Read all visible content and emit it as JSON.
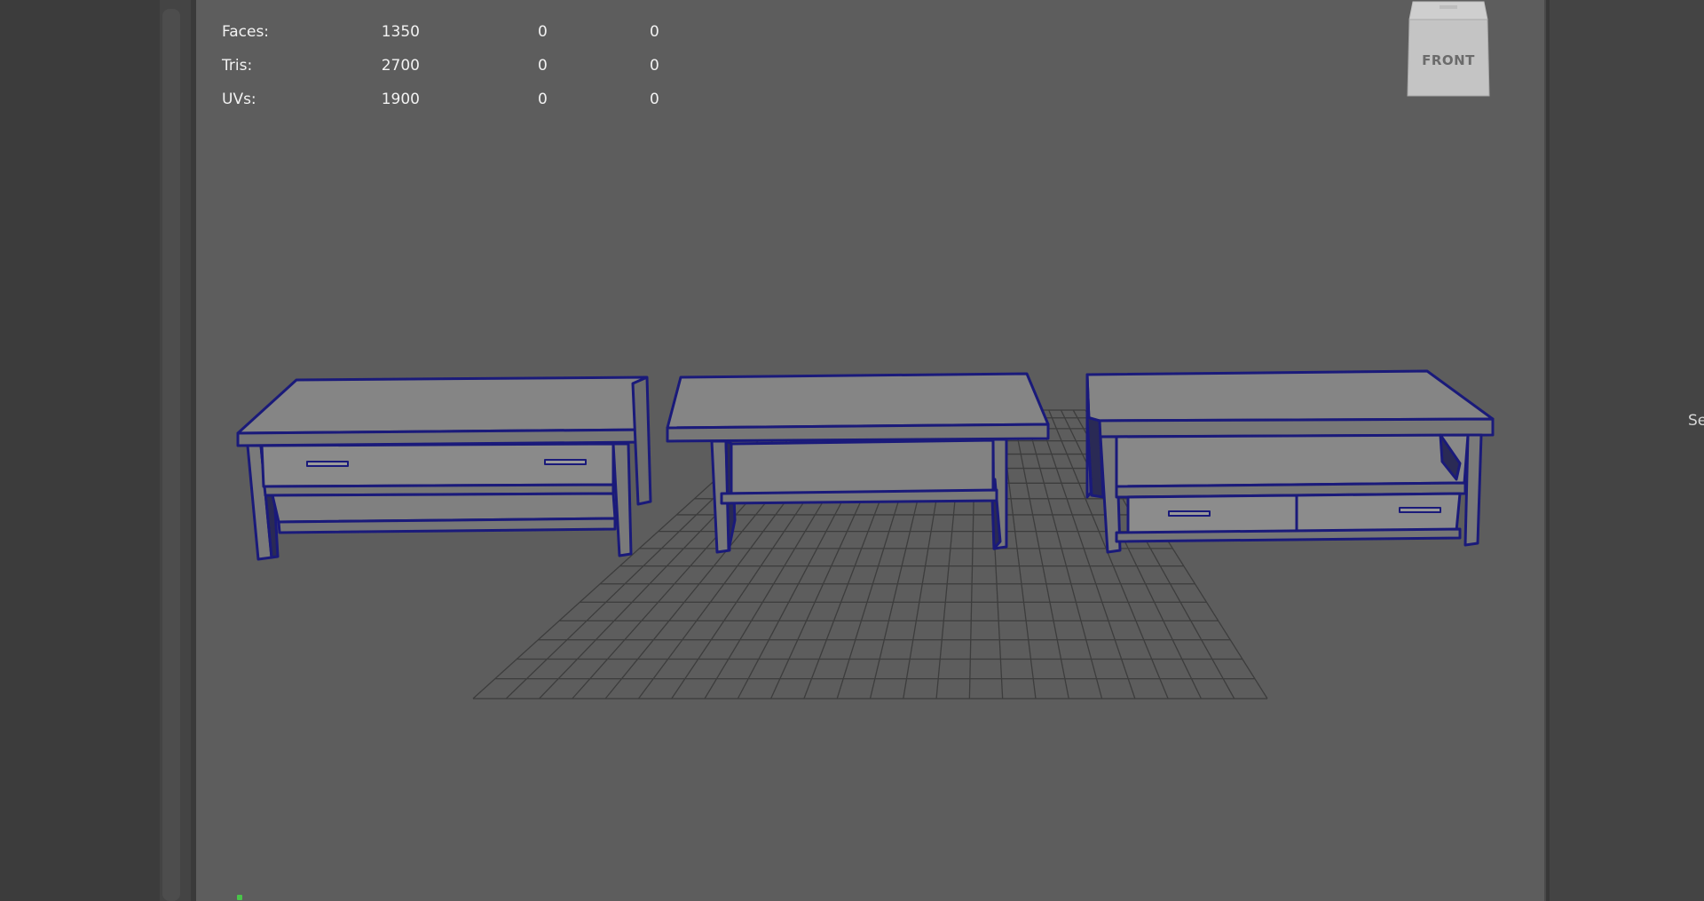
{
  "hud": {
    "rows": [
      {
        "label": "Faces:",
        "v1": "1350",
        "v2": "0",
        "v3": "0"
      },
      {
        "label": "Tris:",
        "v1": "2700",
        "v2": "0",
        "v3": "0"
      },
      {
        "label": "UVs:",
        "v1": "1900",
        "v2": "0",
        "v3": "0"
      }
    ]
  },
  "viewcube": {
    "label": "FRONT"
  },
  "right_panel": {
    "partial_label": "Se"
  },
  "colors": {
    "viewport_bg": "#5d5d5d",
    "wireframe": "#1a1a7a",
    "furniture_fill": "#8a8a8a",
    "grid": "#3e3e3e"
  }
}
